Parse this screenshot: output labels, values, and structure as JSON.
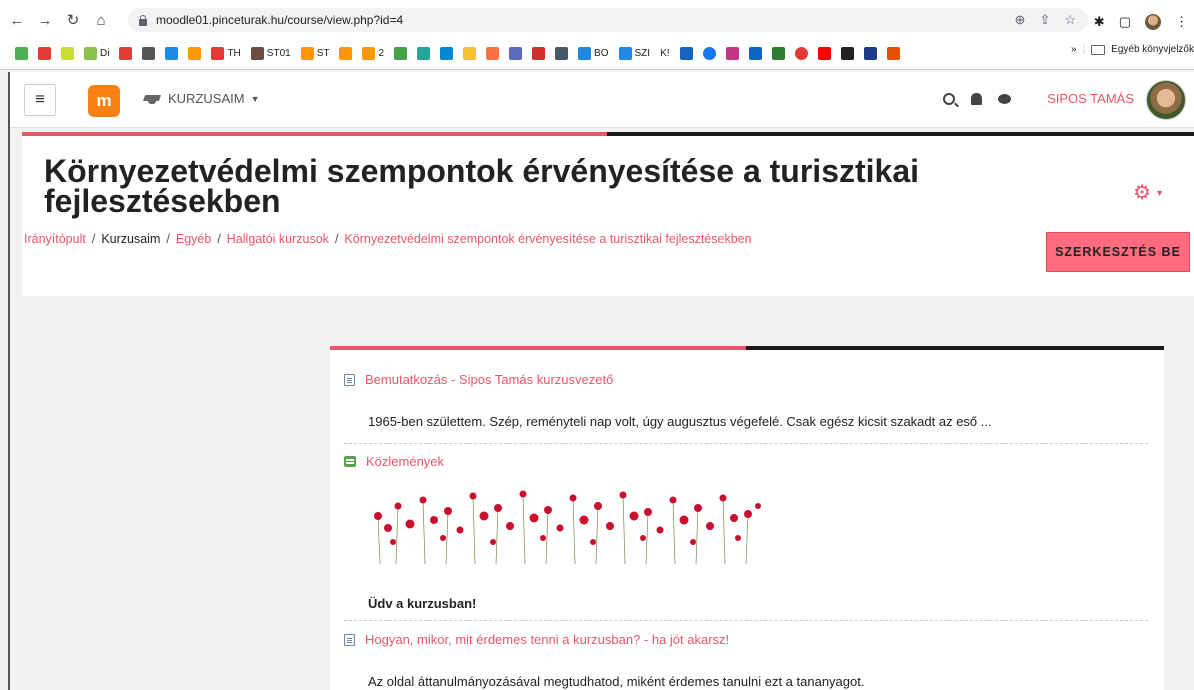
{
  "browser": {
    "url": "moodle01.pinceturak.hu/course/view.php?id=4",
    "bookmarks": [
      {
        "label": "Di",
        "color": "#8bc34a"
      },
      {
        "label": "",
        "color": "#e53935"
      },
      {
        "label": "TH",
        "color": "#e53935"
      },
      {
        "label": "ST01",
        "color": "#6d4c41"
      },
      {
        "label": "ST",
        "color": "#ff9800"
      },
      {
        "label": "2",
        "color": "#ff9800"
      },
      {
        "label": "BO",
        "color": "#1e88e5"
      },
      {
        "label": "SZI",
        "color": "#1e88e5"
      },
      {
        "label": "K!",
        "color": "#c62828"
      }
    ],
    "bookmarks_folder": "Egyéb könyvjelzők"
  },
  "navbar": {
    "logo_text": "m",
    "courses_menu": "KURZUSAIM",
    "user_name": "SIPOS TAMÁS"
  },
  "header": {
    "title": "Környezetvédelmi szempontok érvényesítése a turisztikai fejlesztésekben",
    "breadcrumb": {
      "dashboard": "Irányítópult",
      "my_courses": "Kurzusaim",
      "other": "Egyéb",
      "student_courses": "Hallgatói kurzusok",
      "course": "Környezetvédelmi szempontok érvényesítése a turisztikai fejlesztésekben"
    },
    "edit_button": "SZERKESZTÉS BE"
  },
  "content": {
    "activity1": {
      "title": "Bemutatkozás - Sipos Tamás kurzusvezető",
      "desc": "1965-ben születtem. Szép, reményteli nap volt, úgy augusztus végefelé. Csak egész kicsit szakadt az eső ..."
    },
    "activity2": {
      "title": "Közlemények",
      "welcome": "Üdv a kurzusban!"
    },
    "activity3": {
      "title": "Hogyan, mikor, mit érdemes tenni a kurzusban? - ha jót akarsz!",
      "desc": "Az oldal áttanulmányozásával megtudhatod, miként érdemes tanulni ezt a tananyagot."
    }
  },
  "colors": {
    "accent": "#e9566a",
    "moodle_orange": "#f98012"
  }
}
